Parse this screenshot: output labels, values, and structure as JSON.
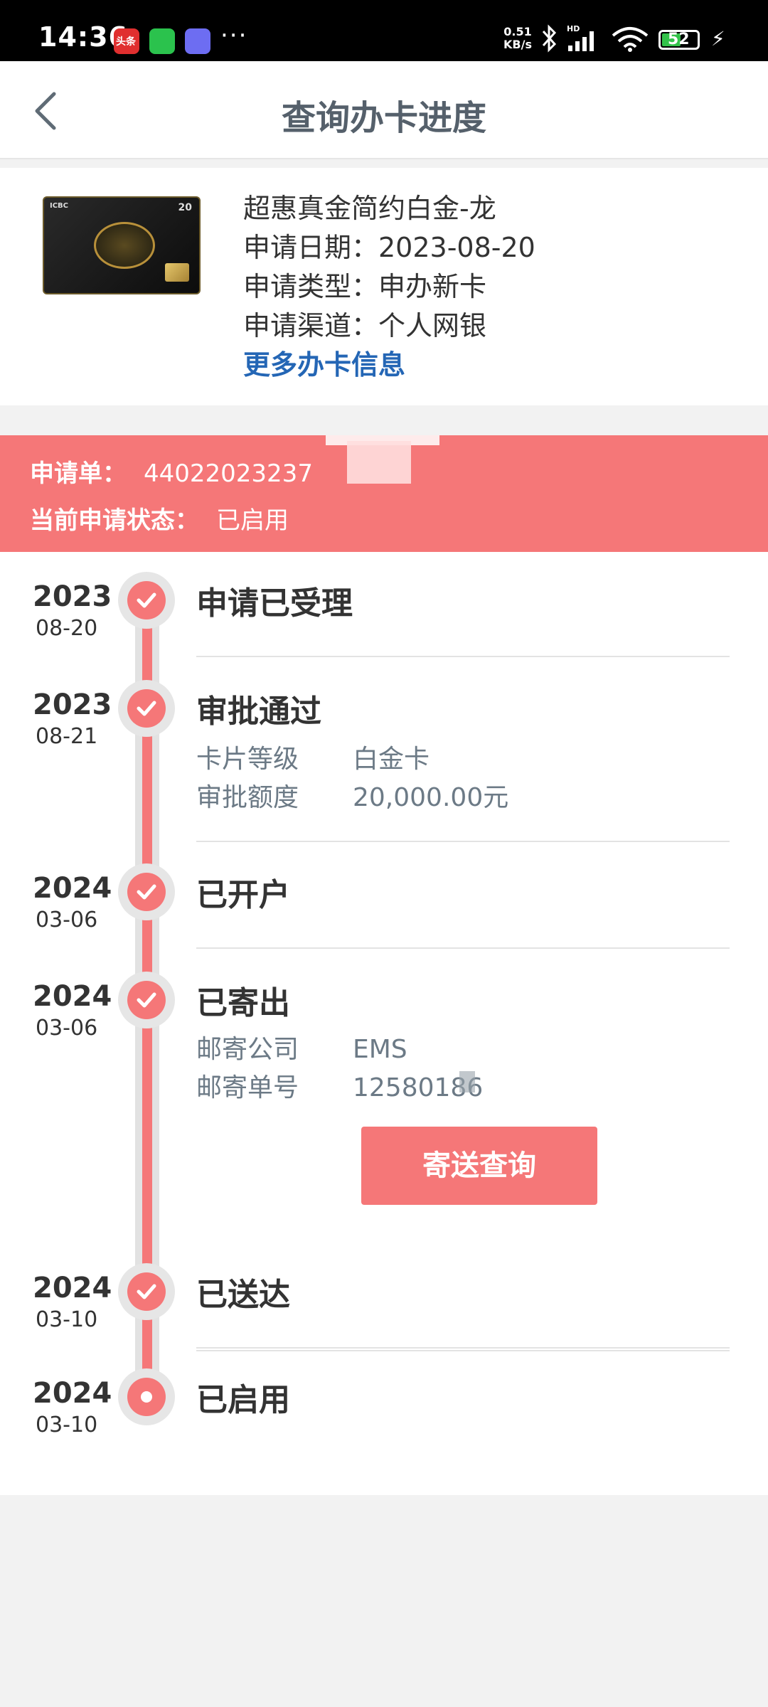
{
  "status_bar": {
    "time": "14:36",
    "speed": [
      "0.51",
      "KB/s"
    ],
    "battery": "52",
    "app1_text": "头条"
  },
  "header": {
    "title": "查询办卡进度"
  },
  "card": {
    "name": "超惠真金简约白金-龙",
    "apply_date": "申请日期：2023-08-20",
    "apply_type": "申请类型：申办新卡",
    "apply_channel": "申请渠道：个人网银",
    "more_link": "更多办卡信息",
    "image_logo": "ICBC",
    "image_badge": "20"
  },
  "application": {
    "number_label": "申请单：",
    "number_value": "44022023237",
    "status_label": "当前申请状态：",
    "status_value": "已启用"
  },
  "timeline": {
    "steps": [
      {
        "year": "2023",
        "date": "08-20",
        "title": "申请已受理"
      },
      {
        "year": "2023",
        "date": "08-21",
        "title": "审批通过",
        "details": [
          {
            "k": "卡片等级",
            "v": "白金卡"
          },
          {
            "k": "审批额度",
            "v": "20,000.00元"
          }
        ]
      },
      {
        "year": "2024",
        "date": "03-06",
        "title": "已开户"
      },
      {
        "year": "2024",
        "date": "03-06",
        "title": "已寄出",
        "details": [
          {
            "k": "邮寄公司",
            "v": "EMS"
          },
          {
            "k": "邮寄单号",
            "v": "12580186"
          }
        ]
      },
      {
        "year": "2024",
        "date": "03-10",
        "title": "已送达"
      },
      {
        "year": "2024",
        "date": "03-10",
        "title": "已启用"
      }
    ],
    "track_button": "寄送查询"
  },
  "colors": {
    "accent": "#f57778",
    "link": "#2466b5",
    "title": "#55606b"
  }
}
